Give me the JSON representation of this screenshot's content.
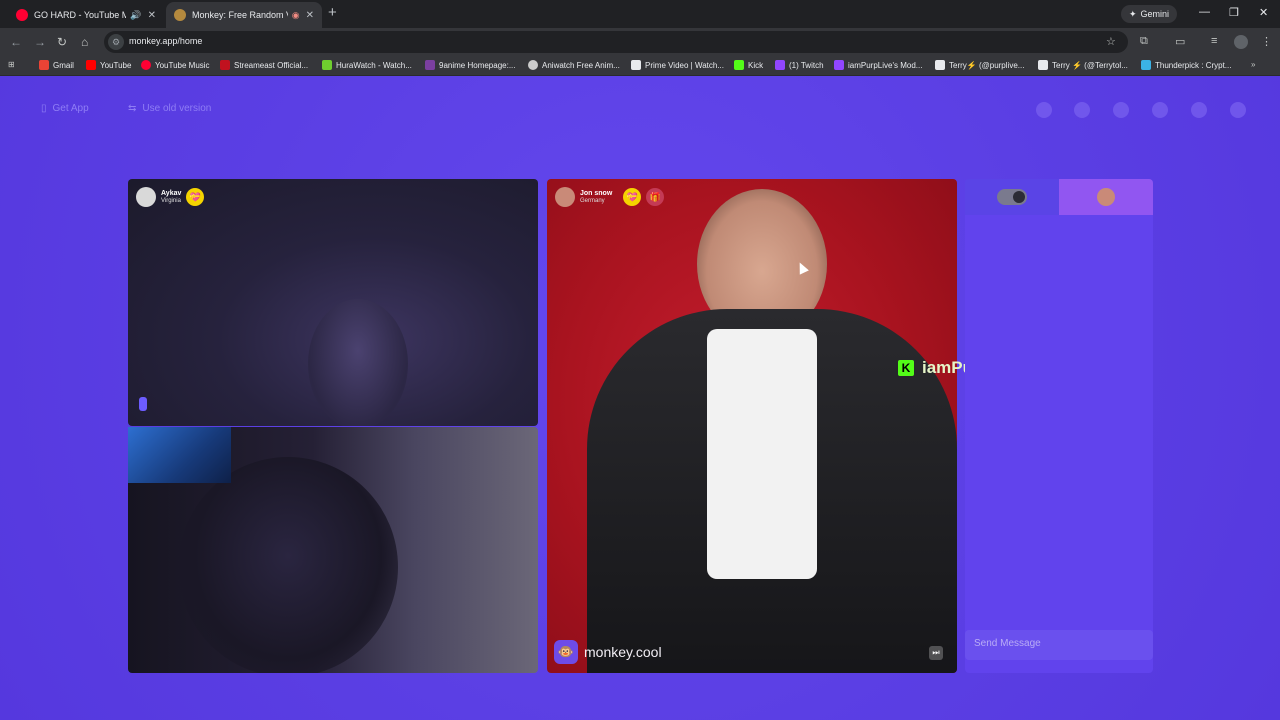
{
  "browser": {
    "tabs": [
      {
        "title": "GO HARD - YouTube Music",
        "active": false,
        "favicon_color": "#ff0033"
      },
      {
        "title": "Monkey: Free Random Vid",
        "active": true,
        "favicon_color": "#b58a3e"
      }
    ],
    "gemini_label": "Gemini",
    "url": "monkey.app/home",
    "bookmarks": [
      {
        "label": "Gmail",
        "color": "#ea4335"
      },
      {
        "label": "YouTube",
        "color": "#ff0000"
      },
      {
        "label": "YouTube Music",
        "color": "#ff0033"
      },
      {
        "label": "Streameast Official...",
        "color": "#c1121f"
      },
      {
        "label": "HuraWatch - Watch...",
        "color": "#6fcf2f"
      },
      {
        "label": "9anime Homepage:...",
        "color": "#7b3fa0"
      },
      {
        "label": "Aniwatch Free Anim...",
        "color": "#cccccc"
      },
      {
        "label": "Prime Video | Watch...",
        "color": "#e8eaed"
      },
      {
        "label": "Kick",
        "color": "#53fc18"
      },
      {
        "label": "(1) Twitch",
        "color": "#9146ff"
      },
      {
        "label": "iamPurpLive's Mod...",
        "color": "#9146ff"
      },
      {
        "label": "Terry⚡ (@purplive...",
        "color": "#e8eaed"
      },
      {
        "label": "Terry ⚡ (@Terrytol...",
        "color": "#e8eaed"
      },
      {
        "label": "Thunderpick : Crypt...",
        "color": "#3bb3e6"
      }
    ]
  },
  "page": {
    "get_app": "Get App",
    "old_version": "Use old version",
    "user1": {
      "name": "Aykav",
      "location": "Virginia"
    },
    "user2": {
      "name": "Jon snow",
      "location": "Germany"
    },
    "watermark": "monkey.cool",
    "overlay_name": "iamPurp",
    "overlay_count": "1",
    "send_placeholder": "Send Message"
  }
}
